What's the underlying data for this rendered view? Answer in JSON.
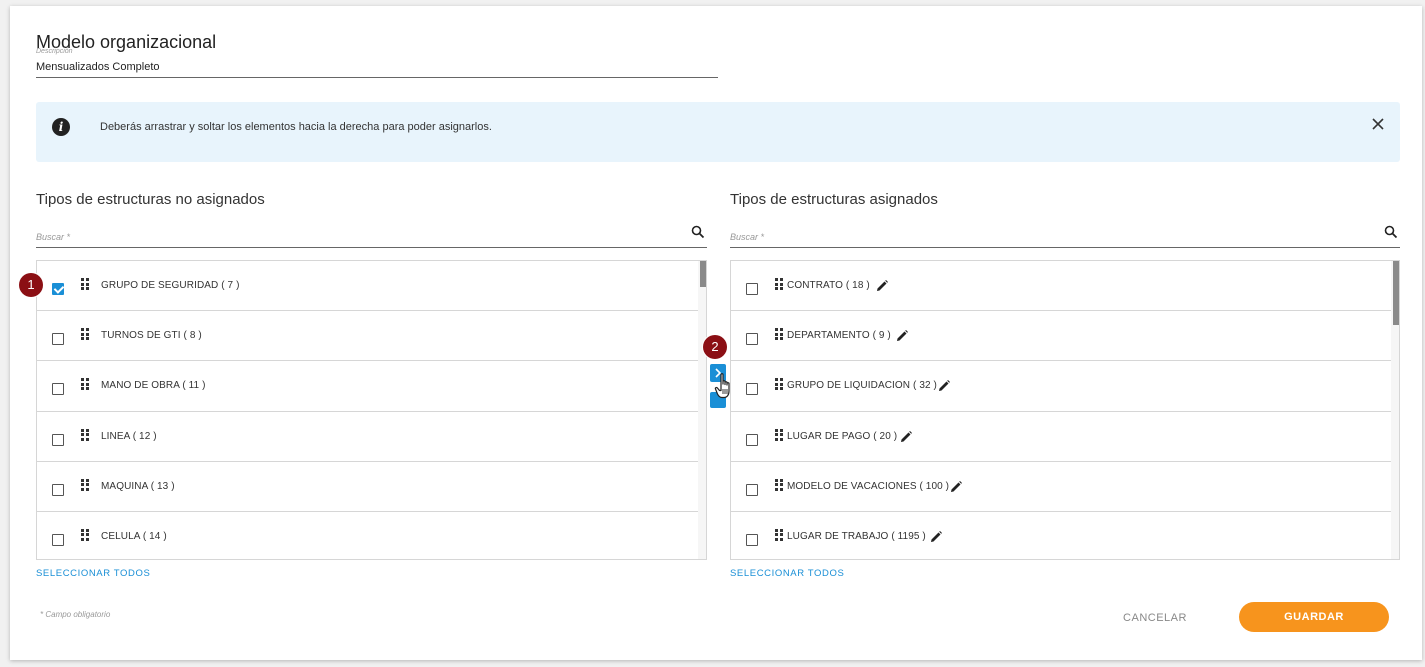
{
  "form": {
    "title": "Modelo organizacional",
    "description_label": "Descripción",
    "description_value": "Mensualizados Completo"
  },
  "info_banner": {
    "icon": "info-icon",
    "text": "Deberás arrastrar y soltar los elementos hacia la derecha para poder asignarlos.",
    "close_icon": "close-icon"
  },
  "unassigned": {
    "title": "Tipos de estructuras no asignados",
    "search_label": "Buscar *",
    "select_all": "SELECCIONAR TODOS",
    "items": [
      {
        "label": "GRUPO DE SEGURIDAD ( 7 )",
        "checked": true
      },
      {
        "label": "TURNOS DE GTI ( 8 )",
        "checked": false
      },
      {
        "label": "MANO DE OBRA ( 11 )",
        "checked": false
      },
      {
        "label": "LINEA ( 12 )",
        "checked": false
      },
      {
        "label": "MAQUINA ( 13 )",
        "checked": false
      },
      {
        "label": "CELULA ( 14 )",
        "checked": false
      }
    ]
  },
  "assigned": {
    "title": "Tipos de estructuras asignados",
    "search_label": "Buscar *",
    "select_all": "SELECCIONAR TODOS",
    "items": [
      {
        "label": "CONTRATO ( 18 )",
        "checked": false
      },
      {
        "label": "DEPARTAMENTO ( 9 )",
        "checked": false
      },
      {
        "label": "GRUPO DE LIQUIDACION ( 32 )",
        "checked": false
      },
      {
        "label": "LUGAR DE PAGO ( 20 )",
        "checked": false
      },
      {
        "label": "MODELO DE VACACIONES ( 100 )",
        "checked": false
      },
      {
        "label": "LUGAR DE TRABAJO ( 1195 )",
        "checked": false
      }
    ]
  },
  "footer": {
    "required_note": "* Campo obligatorio",
    "cancel_label": "CANCELAR",
    "save_label": "GUARDAR"
  },
  "annotations": {
    "step1": "1",
    "step2": "2"
  },
  "colors": {
    "accent": "#1a8fd6",
    "save": "#f7941d",
    "badge": "#8b0f14",
    "banner": "#e8f4fc"
  }
}
